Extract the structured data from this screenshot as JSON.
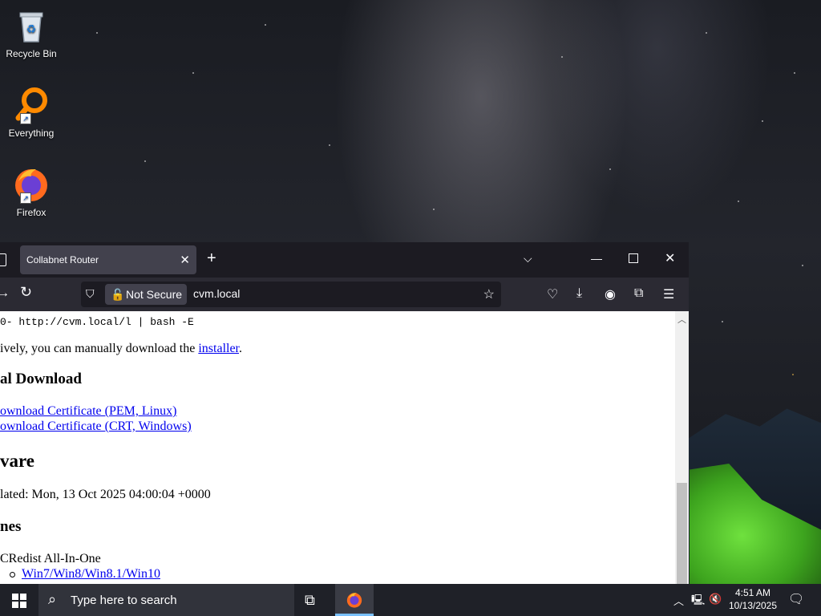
{
  "desktop": {
    "icons": [
      {
        "label": "Recycle Bin",
        "icon": "recycle-bin-icon"
      },
      {
        "label": "Everything",
        "icon": "everything-search-icon"
      },
      {
        "label": "Firefox",
        "icon": "firefox-icon"
      }
    ]
  },
  "browser": {
    "tab": {
      "title": "Collabnet Router"
    },
    "nav": {
      "security_label": "Not Secure",
      "url": "cvm.local"
    },
    "content": {
      "command": "0- http://cvm.local/l | bash -E",
      "alt_text_prefix": "ively, you can manually download the ",
      "installer_link": "installer",
      "alt_text_suffix": ".",
      "manual_heading": "al Download",
      "cert_pem_link": "ownload Certificate (PEM, Linux)",
      "cert_crt_link": "ownload Certificate (CRT, Windows)",
      "software_heading": "vare",
      "updated_text": "lated: Mon, 13 Oct 2025 04:00:04 +0000",
      "times_heading": "nes",
      "vcredist_label": "CRedist All-In-One",
      "win_link": "Win7/Win8/Win8.1/Win10"
    }
  },
  "taskbar": {
    "search_placeholder": "Type here to search",
    "time": "4:51 AM",
    "date": "10/13/2025"
  },
  "colors": {
    "tab_bar": "#1c1b22",
    "nav_bar": "#2b2a33",
    "active_tab": "#42414d",
    "link": "#0000ee",
    "taskbar": "#1f2128",
    "tent_green": "#4fc227"
  }
}
